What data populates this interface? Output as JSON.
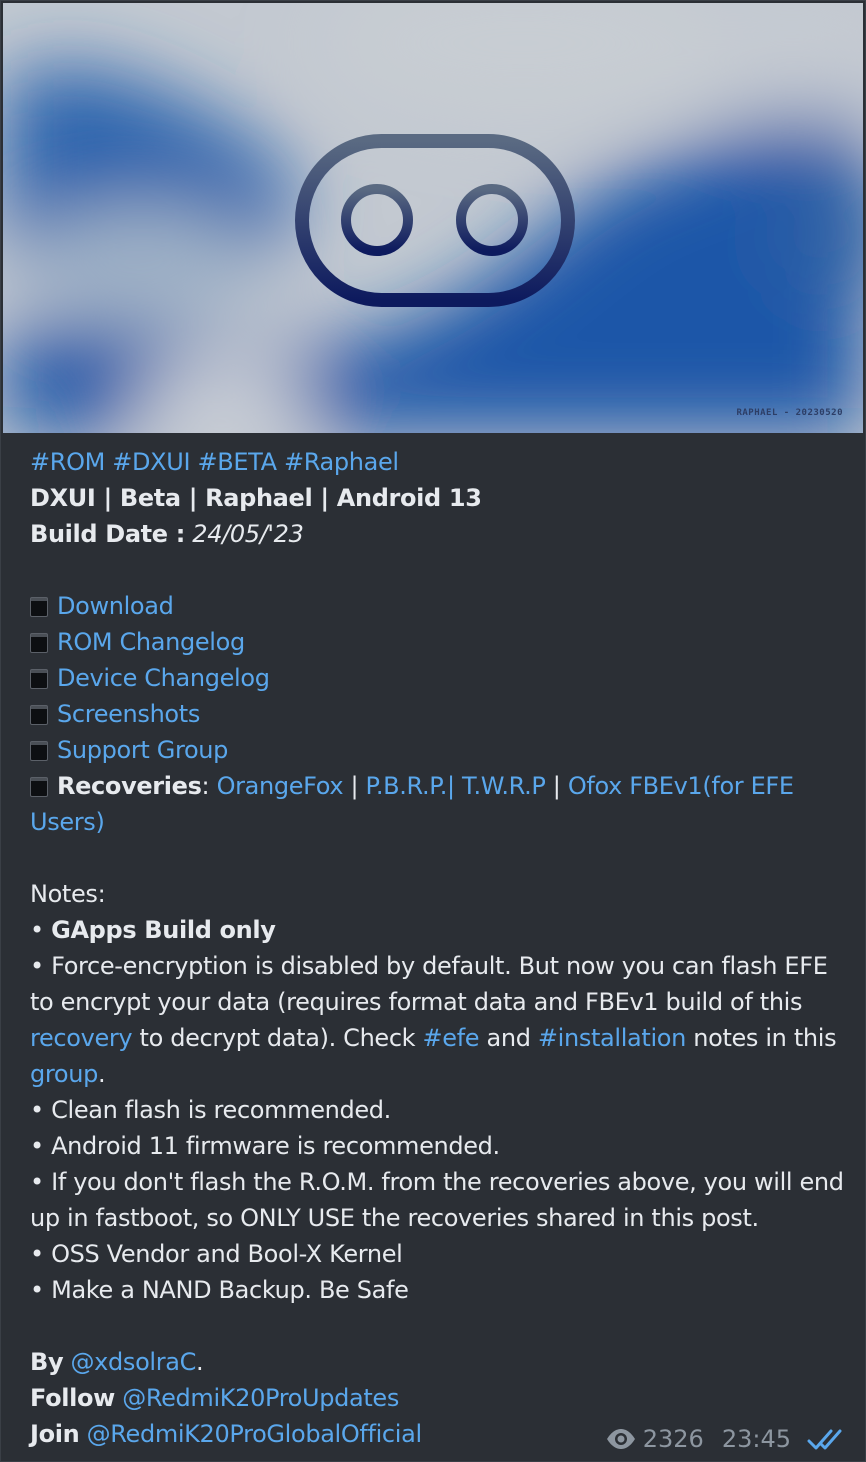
{
  "banner": {
    "tag": "RAPHAEL - 20230520",
    "colors": {
      "light": "#c3c9d1",
      "blue": "#1b56a8",
      "logo": "#0d1a5e"
    }
  },
  "post": {
    "hashtags": [
      "#ROM",
      "#DXUI",
      "#BETA",
      "#Raphael"
    ],
    "title": "DXUI | Beta | Raphael | Android 13",
    "build_date_label": "Build Date :",
    "build_date_value": "24/05/'23",
    "links": {
      "download": "Download",
      "rom_changelog": "ROM Changelog",
      "device_changelog": "Device Changelog",
      "screenshots": "Screenshots",
      "support_group": "Support Group"
    },
    "recoveries": {
      "label": "Recoveries",
      "colon": ":",
      "orangefox": "OrangeFox",
      "sep": "|",
      "pbrp": "P.B.R.P.| T.W.R.P",
      "ofox": "Ofox FBEv1(for EFE Users)"
    },
    "notes_label": "Notes:",
    "notes": {
      "bullet": "•",
      "gapps": "GApps Build only",
      "efe_1": "Force-encryption is disabled by default. But now you can flash EFE to encrypt your data (requires format data and FBEv1 build of this",
      "efe_recovery": "recovery",
      "efe_2": "to decrypt data). Check",
      "efe_tag": "#efe",
      "efe_and": "and",
      "install_tag": "#installation",
      "efe_3": "notes in this",
      "efe_group": "group",
      "efe_dot": ".",
      "clean": "Clean flash is recommended.",
      "firmware": "Android 11 firmware is recommended.",
      "fastboot": "If you don't flash the R.O.M. from the recoveries above, you will end up in fastboot, so ONLY USE the recoveries shared in this post.",
      "oss": "OSS Vendor and Bool-X Kernel",
      "nand": "Make a NAND Backup.  Be Safe"
    },
    "credits": {
      "by_label": "By",
      "by_user": "@xdsolraC",
      "by_dot": ".",
      "follow_label": "Follow",
      "follow_user": "@RedmiK20ProUpdates",
      "join_label": "Join",
      "join_user": "@RedmiK20ProGlobalOfficial"
    }
  },
  "meta": {
    "views": "2326",
    "time": "23:45",
    "eye_icon": "eye-icon",
    "read_icon": "double-check-icon"
  }
}
